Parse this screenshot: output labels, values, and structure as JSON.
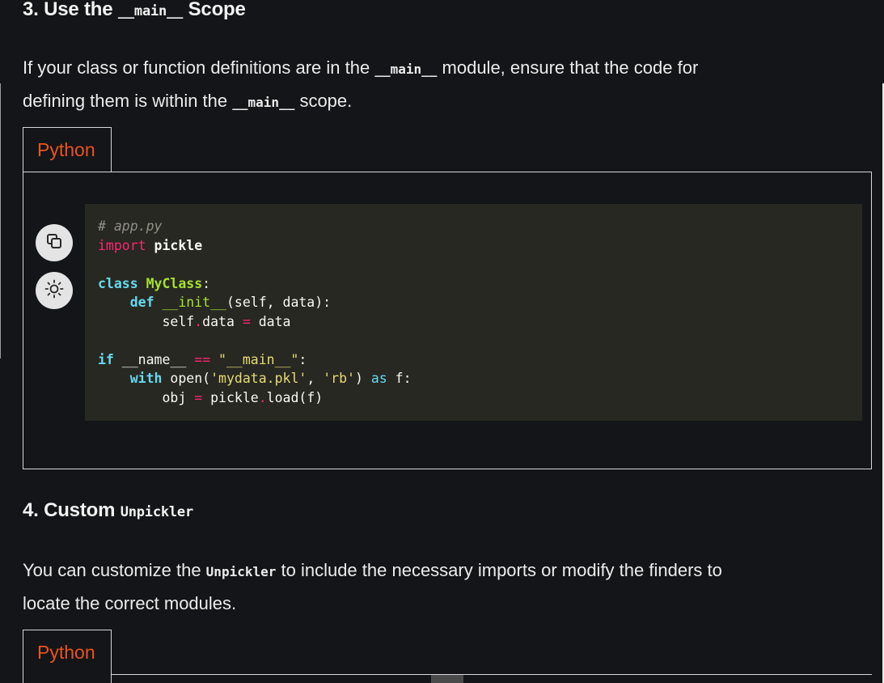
{
  "section3": {
    "heading_number": "3. Use the ",
    "heading_code": "__main__",
    "heading_tail": " Scope",
    "para_line1_a": "If your class or function definitions are in the ",
    "para_line1_code": "__main__",
    "para_line1_b": " module, ensure that the code for",
    "para_line2_a": "defining them is within the ",
    "para_line2_code": "__main__",
    "para_line2_b": " scope.",
    "tab_label": "Python",
    "code": {
      "comment": "# app.py",
      "import_kw": "import",
      "import_mod": " pickle",
      "class_kw": "class",
      "class_name": " MyClass",
      "class_colon": ":",
      "def_indent": "    ",
      "def_kw": "def",
      "def_name": " __init__",
      "def_args": "(self, data):",
      "assign_indent": "        ",
      "assign_lhs1": "self",
      "assign_dot": ".",
      "assign_lhs2": "data",
      "assign_eq": " = ",
      "assign_rhs": "data",
      "if_kw": "if",
      "if_name": " __name__",
      "if_eq": " == ",
      "if_str": "\"__main__\"",
      "if_colon": ":",
      "with_indent": "    ",
      "with_kw": "with",
      "with_open": " open(",
      "with_str1": "'mydata.pkl'",
      "with_comma": ", ",
      "with_str2": "'rb'",
      "with_close": ") ",
      "with_as": "as",
      "with_f": " f:",
      "obj_indent": "        ",
      "obj_lhs": "obj",
      "obj_eq": " = ",
      "obj_mod": "pickle",
      "obj_dot": ".",
      "obj_call": "load(f)"
    }
  },
  "section4": {
    "heading_number": "4. Custom ",
    "heading_code": "Unpickler",
    "para_line1_a": "You can customize the ",
    "para_line1_code": "Unpickler",
    "para_line1_b": " to include the necessary imports or modify the finders to",
    "para_line2": "locate the correct modules.",
    "tab_label": "Python"
  },
  "icons": {
    "copy": "copy-icon",
    "theme": "sun-icon"
  }
}
